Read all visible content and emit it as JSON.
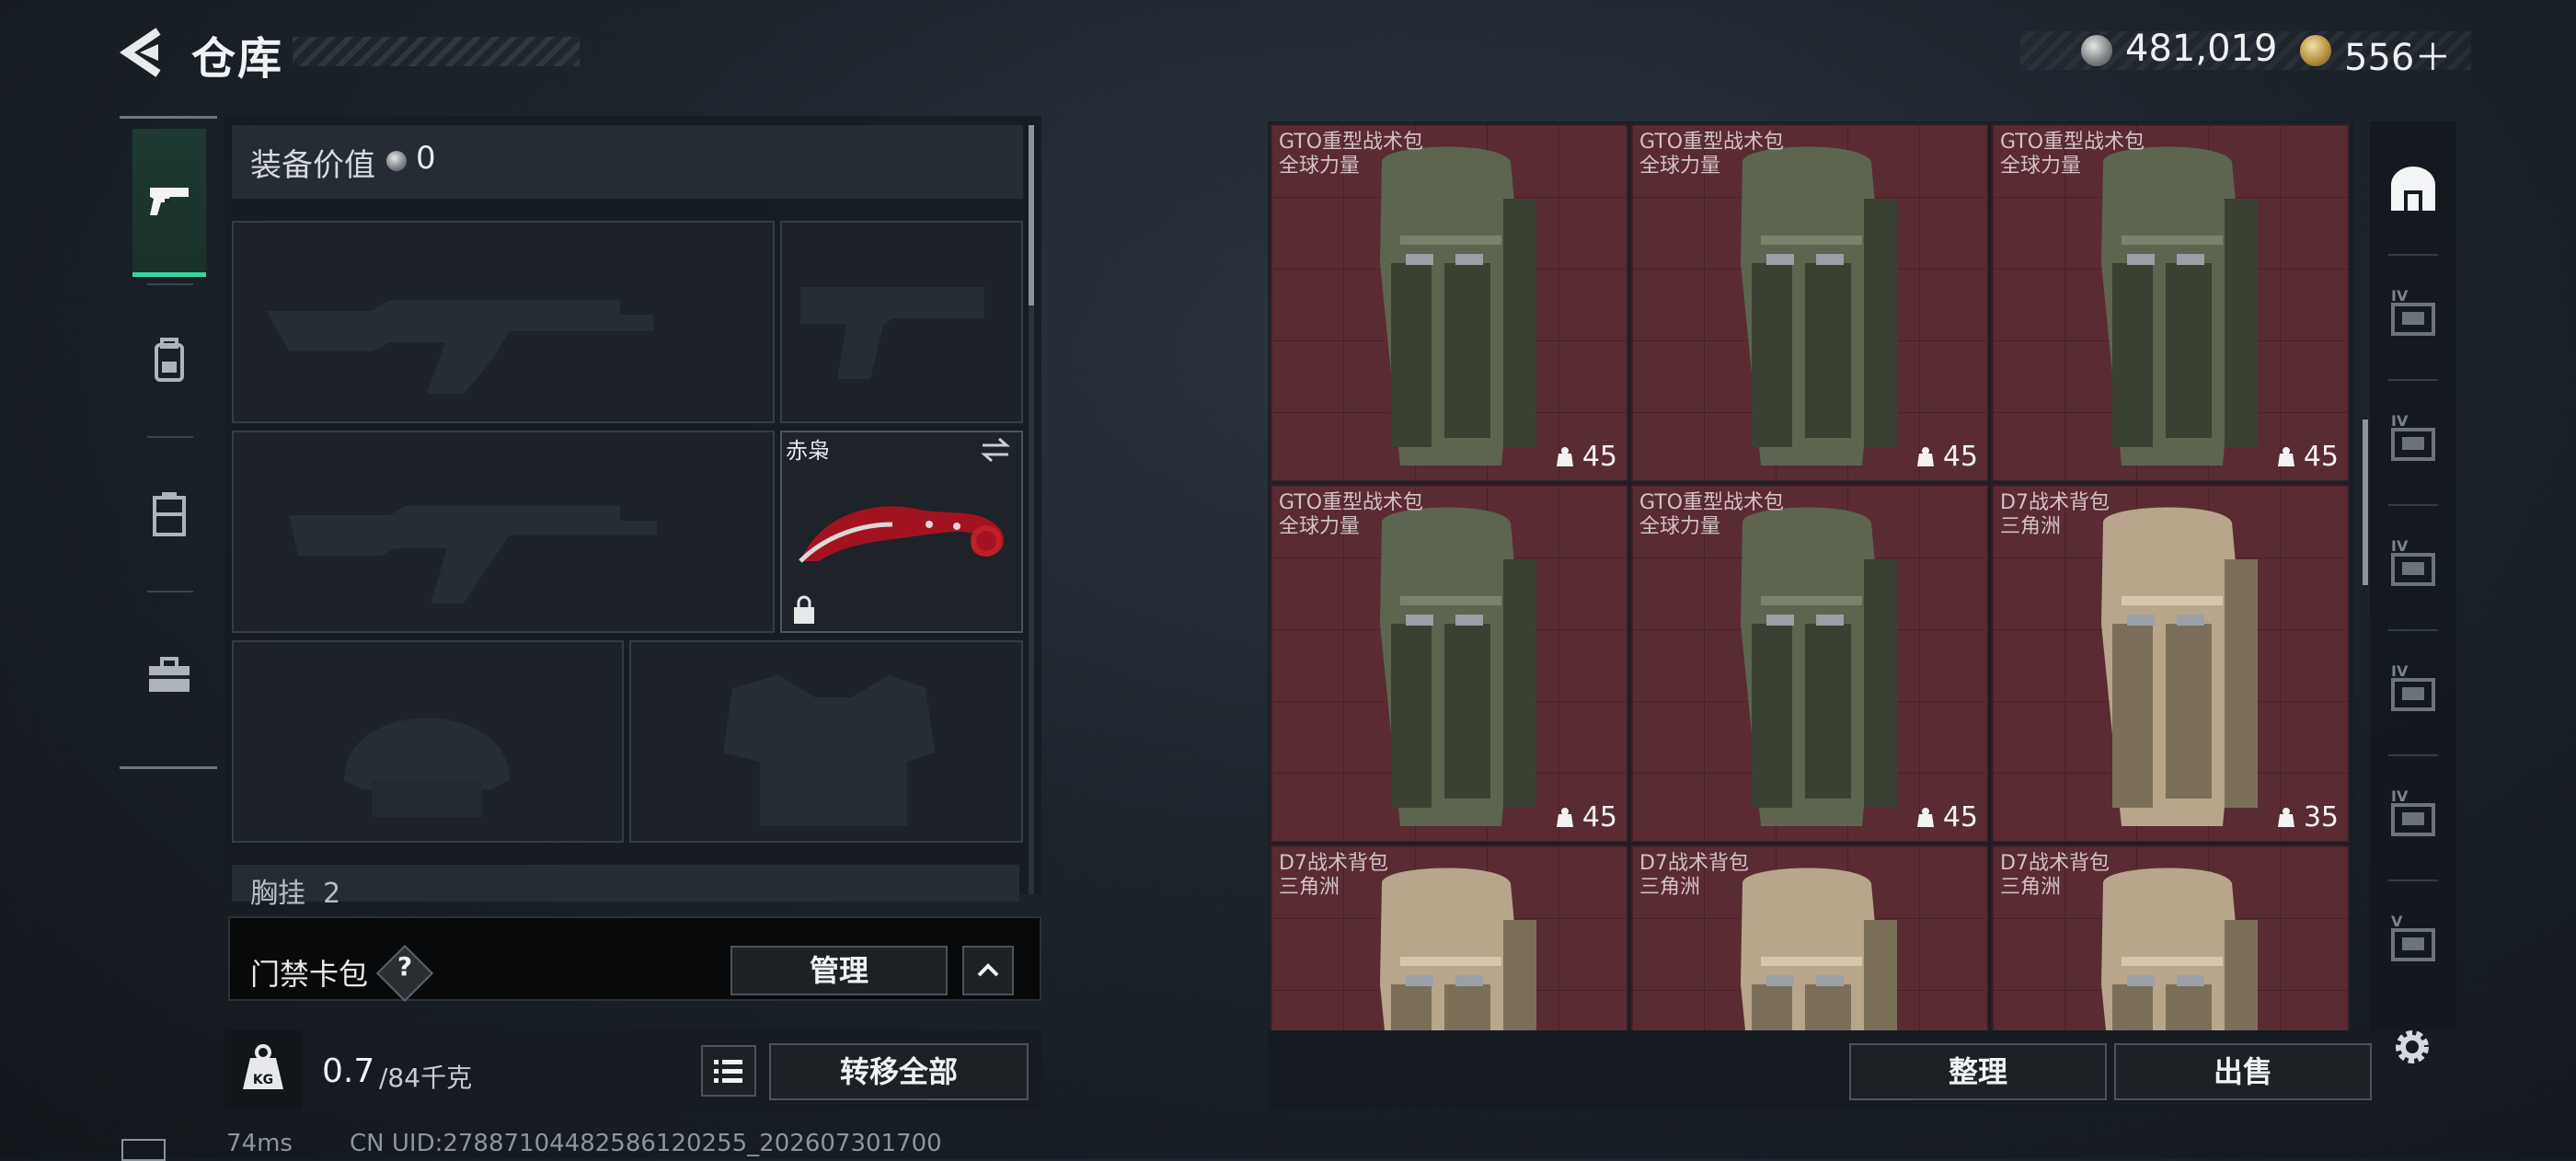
{
  "header": {
    "title": "仓库",
    "money": "481,019",
    "premium": "556＋",
    "icons": [
      "back-arrow-icon",
      "silver-coin-icon",
      "gold-coin-icon"
    ]
  },
  "left_rail": {
    "items": [
      {
        "icon": "pistol-icon",
        "active": true
      },
      {
        "icon": "backpack-icon",
        "active": false
      },
      {
        "icon": "rig-icon",
        "active": false
      },
      {
        "icon": "toolbox-icon",
        "active": false
      }
    ],
    "accent_color": "#38d39f"
  },
  "equipment": {
    "value_label": "装备价值",
    "value": "0",
    "knife_name": "赤枭",
    "chest_label": "胸挂",
    "chest_count": "2"
  },
  "keycard": {
    "label": "门禁卡包",
    "help": "?",
    "manage": "管理"
  },
  "weight": {
    "current": "0.7",
    "max": "/84千克",
    "kg_badge": "KG",
    "transfer_all": "转移全部"
  },
  "status": {
    "ping": "74ms",
    "uid": "CN UID:2788710448258612025​5_202607301700"
  },
  "storage": {
    "items": [
      {
        "name": "GTO重型战术包",
        "brand": "全球力量",
        "capacity": "45",
        "color": "olive"
      },
      {
        "name": "GTO重型战术包",
        "brand": "全球力量",
        "capacity": "45",
        "color": "olive"
      },
      {
        "name": "GTO重型战术包",
        "brand": "全球力量",
        "capacity": "45",
        "color": "olive"
      },
      {
        "name": "GTO重型战术包",
        "brand": "全球力量",
        "capacity": "45",
        "color": "olive"
      },
      {
        "name": "GTO重型战术包",
        "brand": "全球力量",
        "capacity": "45",
        "color": "olive"
      },
      {
        "name": "D7战术背包",
        "brand": "三角洲",
        "capacity": "35",
        "color": "tan"
      },
      {
        "name": "D7战术背包",
        "brand": "三角洲",
        "capacity": "",
        "color": "tan"
      },
      {
        "name": "D7战术背包",
        "brand": "三角洲",
        "capacity": "",
        "color": "tan"
      },
      {
        "name": "D7战术背包",
        "brand": "三角洲",
        "capacity": "",
        "color": "tan"
      }
    ],
    "cell_color": "#5a2b33",
    "organize": "整理",
    "sell": "出售"
  },
  "right_rail": {
    "tabs": [
      {
        "icon": "storage-home-icon",
        "label": "",
        "active": true
      },
      {
        "icon": "storage-tab-1-icon",
        "label": "IV"
      },
      {
        "icon": "storage-tab-2-icon",
        "label": "IV"
      },
      {
        "icon": "storage-tab-3-icon",
        "label": "IV"
      },
      {
        "icon": "storage-tab-4-icon",
        "label": "IV"
      },
      {
        "icon": "storage-tab-5-icon",
        "label": "IV"
      },
      {
        "icon": "storage-tab-6-icon",
        "label": "V"
      }
    ]
  }
}
